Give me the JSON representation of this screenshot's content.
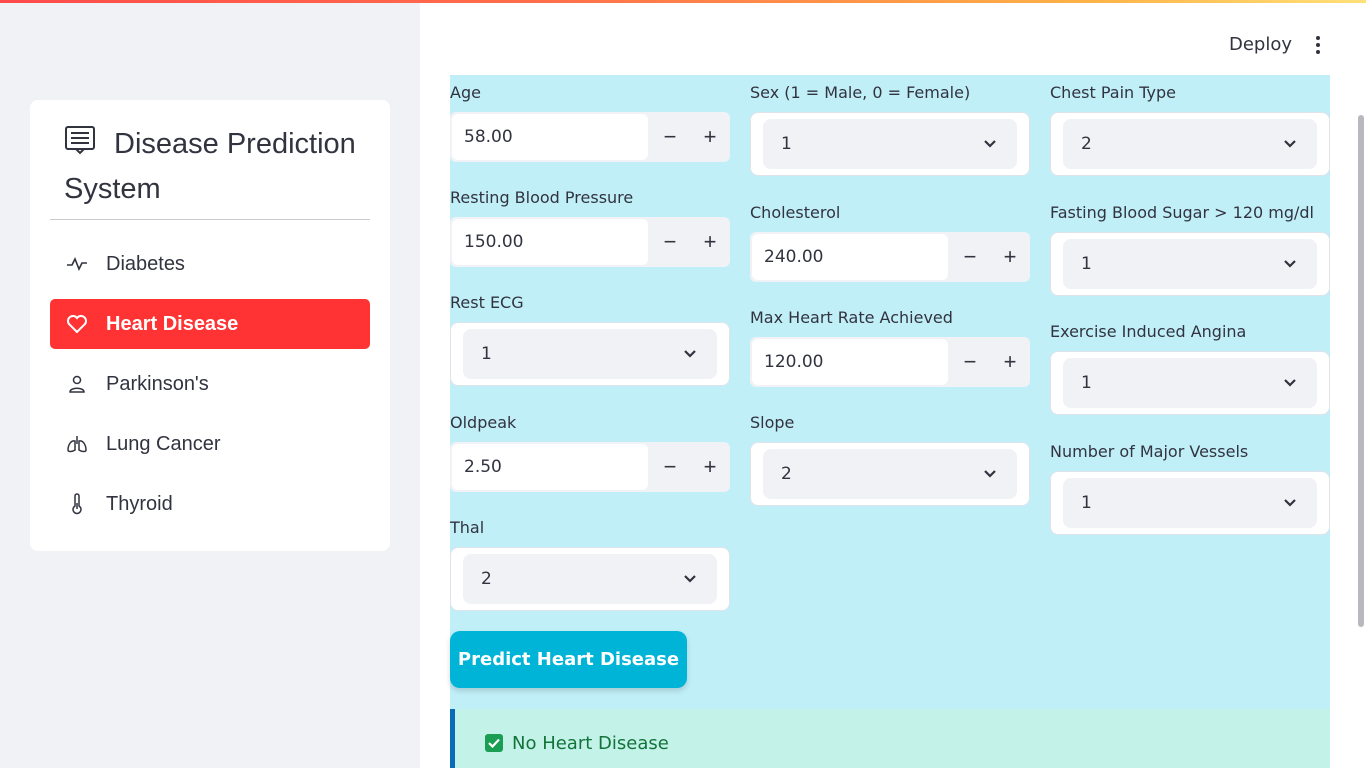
{
  "header": {
    "deploy_label": "Deploy",
    "menu_icon": "kebab-menu-icon"
  },
  "sidebar": {
    "title": "Disease Prediction System",
    "title_icon": "newspaper-icon",
    "items": [
      {
        "label": "Diabetes",
        "icon": "activity-icon",
        "active": false
      },
      {
        "label": "Heart Disease",
        "icon": "heart-icon",
        "active": true
      },
      {
        "label": "Parkinson's",
        "icon": "person-icon",
        "active": false
      },
      {
        "label": "Lung Cancer",
        "icon": "lungs-icon",
        "active": false
      },
      {
        "label": "Thyroid",
        "icon": "thermometer-icon",
        "active": false
      }
    ],
    "active_color": "#ff3333"
  },
  "form": {
    "age": {
      "label": "Age",
      "value": "58.00"
    },
    "sex": {
      "label": "Sex (1 = Male, 0 = Female)",
      "value": "1"
    },
    "chest_pain": {
      "label": "Chest Pain Type",
      "value": "2"
    },
    "resting_bp": {
      "label": "Resting Blood Pressure",
      "value": "150.00"
    },
    "cholesterol": {
      "label": "Cholesterol",
      "value": "240.00"
    },
    "fasting_bs": {
      "label": "Fasting Blood Sugar > 120 mg/dl",
      "value": "1"
    },
    "rest_ecg": {
      "label": "Rest ECG",
      "value": "1"
    },
    "max_hr": {
      "label": "Max Heart Rate Achieved",
      "value": "120.00"
    },
    "exercise_angina": {
      "label": "Exercise Induced Angina",
      "value": "1"
    },
    "oldpeak": {
      "label": "Oldpeak",
      "value": "2.50"
    },
    "slope": {
      "label": "Slope",
      "value": "2"
    },
    "major_vessels": {
      "label": "Number of Major Vessels",
      "value": "1"
    },
    "thal": {
      "label": "Thal",
      "value": "2"
    },
    "stepper_minus": "−",
    "stepper_plus": "+"
  },
  "predict_button": {
    "label": "Predict Heart Disease",
    "color": "#00b4d8"
  },
  "result": {
    "text": "No Heart Disease",
    "status_color": "#1a9e53",
    "background": "#c3f2e8"
  },
  "panel_background": "#c1eff8"
}
